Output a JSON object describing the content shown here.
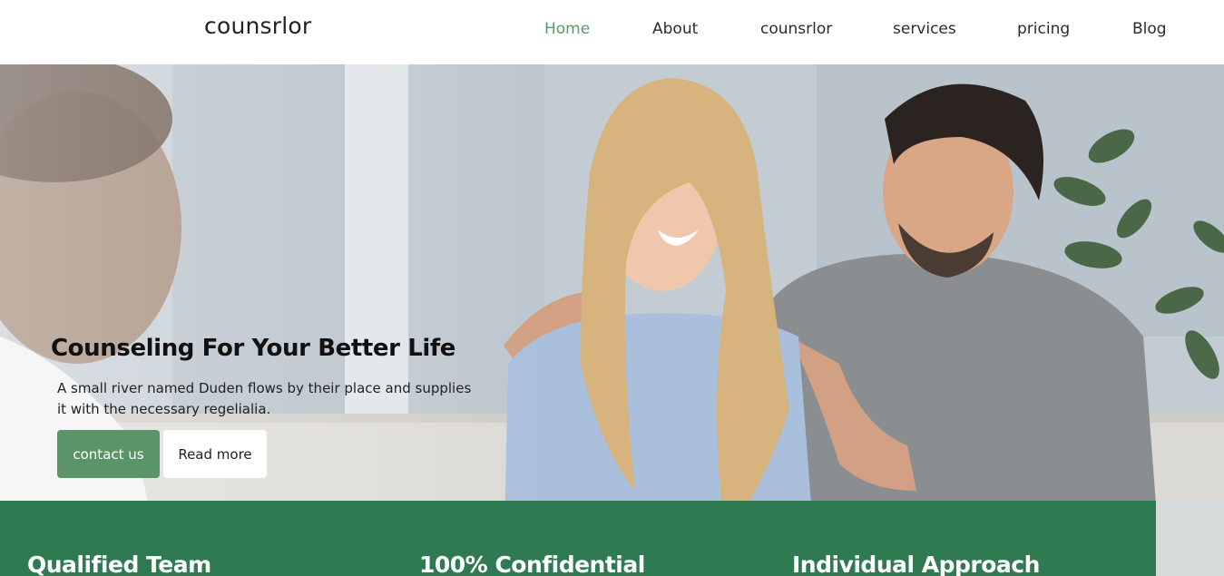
{
  "nav": {
    "brand": "counsrlor",
    "links": [
      {
        "label": "Home",
        "active": true
      },
      {
        "label": "About",
        "active": false
      },
      {
        "label": "counsrlor",
        "active": false
      },
      {
        "label": "services",
        "active": false
      },
      {
        "label": "pricing",
        "active": false
      },
      {
        "label": "Blog",
        "active": false
      }
    ]
  },
  "hero": {
    "title": "Counseling For Your Better Life",
    "text": "A small river named Duden flows by their place and supplies it with the necessary regelialia.",
    "contact_button": "contact us",
    "read_more_button": "Read more"
  },
  "features": [
    {
      "title": "Qualified Team"
    },
    {
      "title": "100% Confidential"
    },
    {
      "title": "Individual Approach"
    }
  ],
  "colors": {
    "accent": "#5b9468",
    "nav_active": "#5a9a6c",
    "feature_band": "#2f7a51"
  }
}
